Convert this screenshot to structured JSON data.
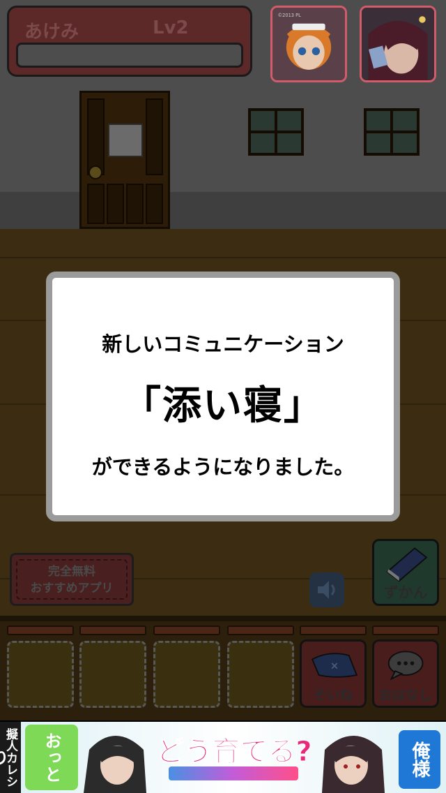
{
  "status": {
    "name": "あけみ",
    "level": "Lv2"
  },
  "popup": {
    "line1": "新しいコミュニケーション",
    "highlight": "「添い寝」",
    "line3": "ができるようになりました。"
  },
  "buttons": {
    "free_apps_line1": "完全無料",
    "free_apps_line2": "おすすめアプリ",
    "zukan": "ずかん",
    "soine": "そいね",
    "ohanashi": "おはなし"
  },
  "portrait_credit": "©2013 PL",
  "ad": {
    "side_text": "擬人カレシ",
    "left_badge": "おっとり",
    "title": "どう育てる?",
    "right_badge": "俺様"
  },
  "colors": {
    "modal_border": "#9b9b9b",
    "portrait_border": "#d25c6a",
    "ad_title": "#e82a7a"
  }
}
